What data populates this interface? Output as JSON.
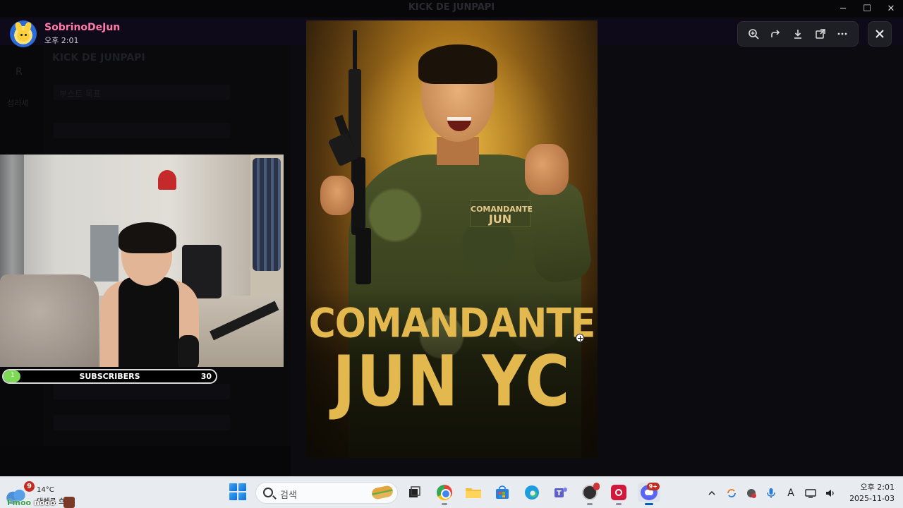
{
  "window": {
    "title": "KICK DE JUNPAPI",
    "minimize_glyph": "─",
    "maximize_glyph": "☐",
    "close_glyph": "✕"
  },
  "viewer": {
    "username": "SobrinoDeJun",
    "timestamp": "오후 2:01",
    "tools": [
      "zoom-in-icon",
      "forward-icon",
      "download-icon",
      "open-external-icon",
      "more-icon"
    ],
    "close_icon": "close-icon"
  },
  "background": {
    "server_name": "KICK DE JUNPAPI",
    "left_letter": "R",
    "left_label": "섭리세",
    "channel_label": "부스트 목표"
  },
  "poster": {
    "patch_line1": "COMANDANTE",
    "patch_line2": "JUN",
    "title_line1": "COMANDANTE",
    "title_line2": "JUN YC"
  },
  "subscribers_bar": {
    "current": "1",
    "label": "SUBSCRIBERS",
    "goal": "30",
    "progress_fraction": 0.08,
    "fill_color": "#7ed957"
  },
  "overlay_chat": {
    "name": "Fmoo",
    "text": "nooo"
  },
  "taskbar": {
    "weather_badge": "9",
    "weather_temp": "14°C",
    "weather_desc": "대체로 흐림",
    "search_placeholder": "검색",
    "apps": [
      "file-explorer",
      "chrome",
      "folder",
      "microsoft-store",
      "edge",
      "teams",
      "obs",
      "recorder",
      "discord"
    ],
    "discord_badge": "9+",
    "clock_time": "오후 2:01",
    "clock_date": "2025-11-03",
    "ime_label": "A"
  }
}
